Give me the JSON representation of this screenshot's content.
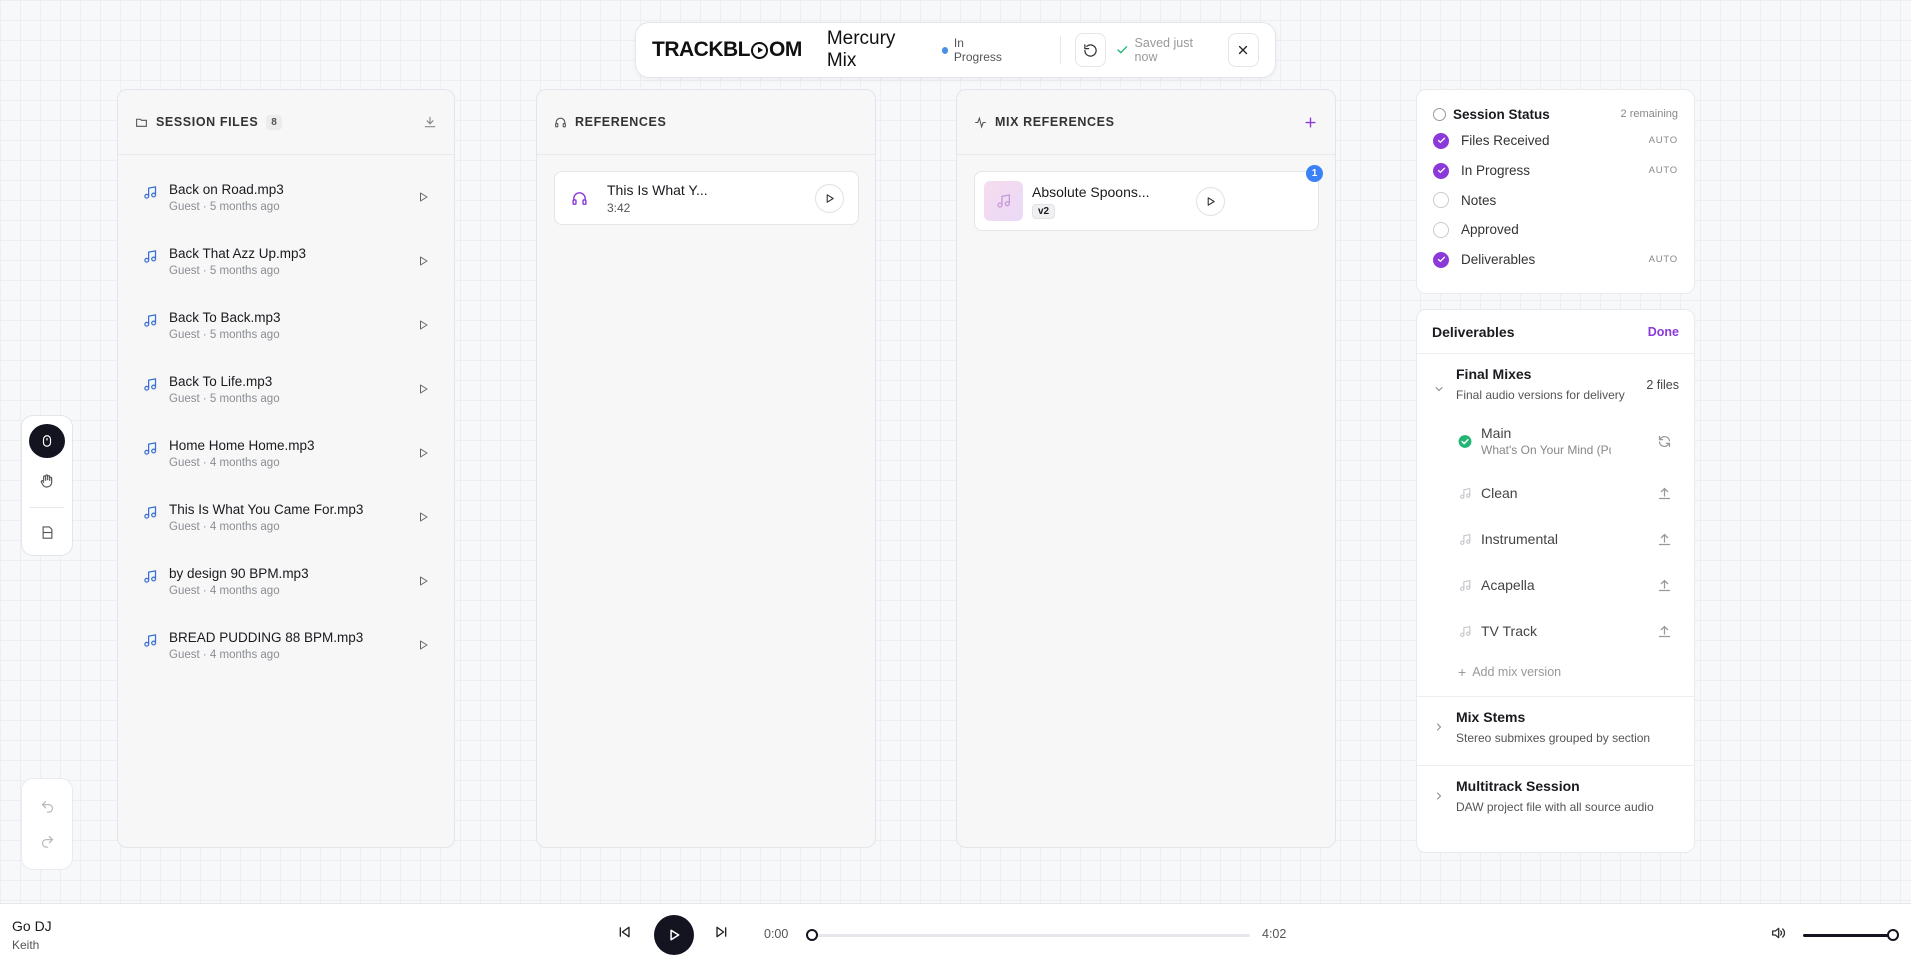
{
  "header": {
    "logo_left": "TRACKBL",
    "logo_right": "OM",
    "project_title": "Mercury Mix",
    "status": "In Progress",
    "saved": "Saved just now"
  },
  "session_files": {
    "title": "SESSION FILES",
    "count": "8",
    "items": [
      {
        "name": "Back on Road.mp3",
        "sub": "Guest · 5 months ago"
      },
      {
        "name": "Back That Azz Up.mp3",
        "sub": "Guest · 5 months ago"
      },
      {
        "name": "Back To Back.mp3",
        "sub": "Guest · 5 months ago"
      },
      {
        "name": "Back To Life.mp3",
        "sub": "Guest · 5 months ago"
      },
      {
        "name": "Home Home Home.mp3",
        "sub": "Guest · 4 months ago"
      },
      {
        "name": "This Is What You Came For.mp3",
        "sub": "Guest · 4 months ago"
      },
      {
        "name": "by design 90 BPM.mp3",
        "sub": "Guest · 4 months ago"
      },
      {
        "name": "BREAD PUDDING 88 BPM.mp3",
        "sub": "Guest · 4 months ago"
      }
    ]
  },
  "references": {
    "title": "REFERENCES",
    "items": [
      {
        "name": "This Is What Y...",
        "duration": "3:42"
      }
    ]
  },
  "mix_references": {
    "title": "MIX REFERENCES",
    "items": [
      {
        "name": "Absolute Spoons...",
        "version": "v2",
        "count": "1"
      }
    ]
  },
  "session_status": {
    "title": "Session Status",
    "remaining": "2 remaining",
    "items": [
      {
        "label": "Files Received",
        "checked": true,
        "tag": "AUTO"
      },
      {
        "label": "In Progress",
        "checked": true,
        "tag": "AUTO"
      },
      {
        "label": "Notes",
        "checked": false,
        "tag": ""
      },
      {
        "label": "Approved",
        "checked": false,
        "tag": ""
      },
      {
        "label": "Deliverables",
        "checked": true,
        "tag": "AUTO"
      }
    ]
  },
  "deliverables": {
    "title": "Deliverables",
    "done_label": "Done",
    "final_mixes": {
      "title": "Final Mixes",
      "desc": "Final audio versions for delivery",
      "count": "2 files",
      "main": {
        "name": "Main",
        "sub": "What's On Your Mind (Pur..."
      },
      "versions": [
        "Clean",
        "Instrumental",
        "Acapella",
        "TV Track"
      ],
      "add_label": "Add mix version"
    },
    "mix_stems": {
      "title": "Mix Stems",
      "desc": "Stereo submixes grouped by section"
    },
    "multitrack": {
      "title": "Multitrack Session",
      "desc": "DAW project file with all source audio"
    }
  },
  "player": {
    "title": "Go DJ",
    "artist": "Keith",
    "current": "0:00",
    "total": "4:02",
    "progress": 0,
    "volume": 1.0
  },
  "colors": {
    "accent": "#8b3ad9",
    "status_dot": "#4a90e2",
    "success": "#22b573",
    "badge_blue": "#3b82f6"
  }
}
